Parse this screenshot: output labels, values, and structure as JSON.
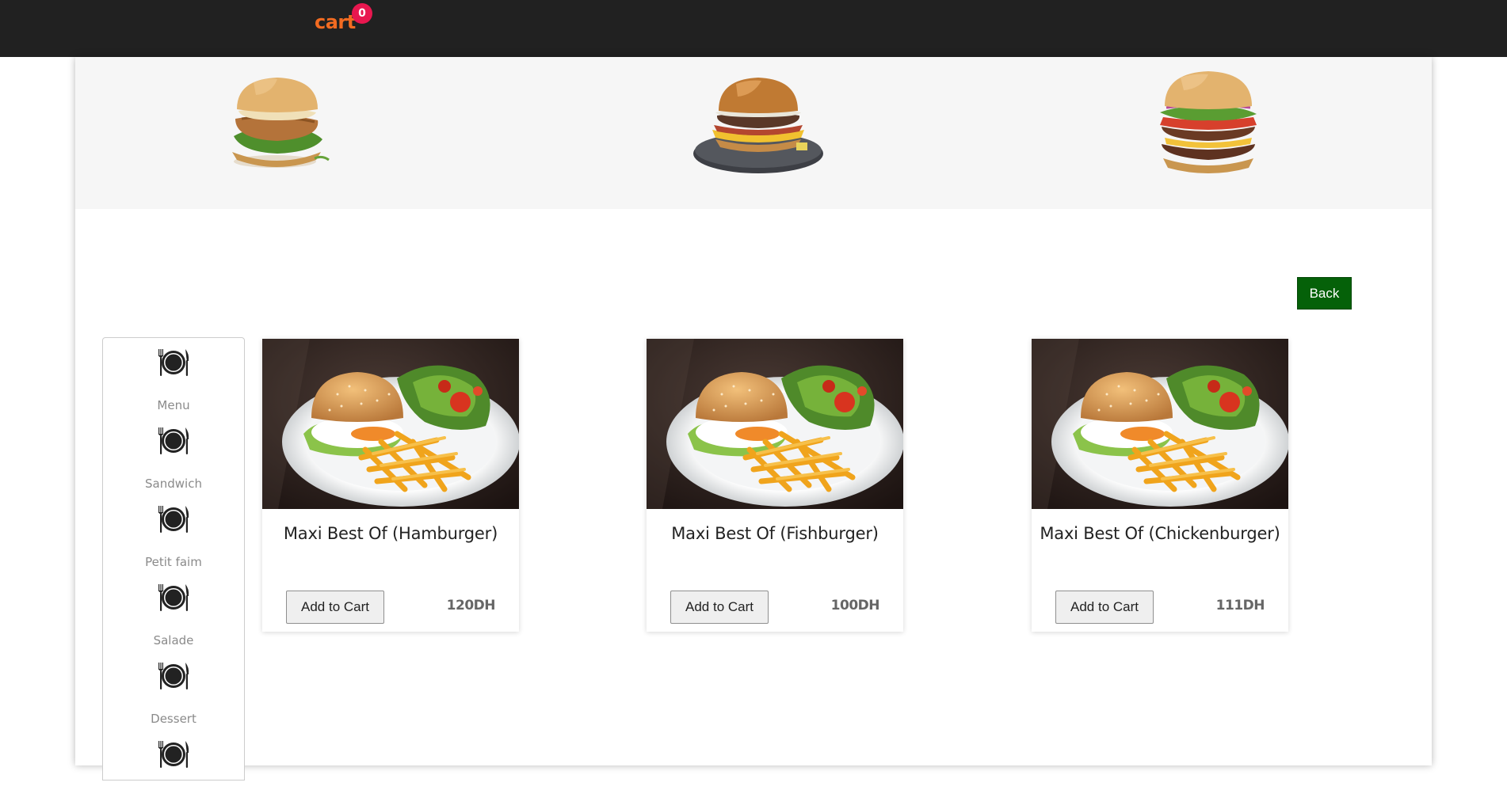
{
  "header": {
    "cart_label": "cart",
    "cart_count": "0",
    "colors": {
      "bar": "#212121",
      "cart": "#f26b21",
      "badge": "#e8174f"
    }
  },
  "hero": {
    "images": [
      "chicken-burger-image",
      "bacon-burger-image",
      "double-burger-image"
    ]
  },
  "actions": {
    "back_label": "Back",
    "back_color": "#056109"
  },
  "sidebar": {
    "items": [
      {
        "label": "Menu",
        "icon": "plate-cutlery-icon"
      },
      {
        "label": "Sandwich",
        "icon": "plate-cutlery-icon"
      },
      {
        "label": "Petit faim",
        "icon": "plate-cutlery-icon"
      },
      {
        "label": "Salade",
        "icon": "plate-cutlery-icon"
      },
      {
        "label": "Dessert",
        "icon": "plate-cutlery-icon"
      },
      {
        "label": "",
        "icon": "plate-cutlery-icon"
      }
    ]
  },
  "products": [
    {
      "name": "Maxi Best Of (Hamburger)",
      "button": "Add to Cart",
      "price": "120DH",
      "image": "burger-fries-plate-image"
    },
    {
      "name": "Maxi Best Of (Fishburger)",
      "button": "Add to Cart",
      "price": "100DH",
      "image": "burger-fries-plate-image"
    },
    {
      "name": "Maxi Best Of (Chickenburger)",
      "button": "Add to Cart",
      "price": "111DH",
      "image": "burger-fries-plate-image"
    }
  ]
}
